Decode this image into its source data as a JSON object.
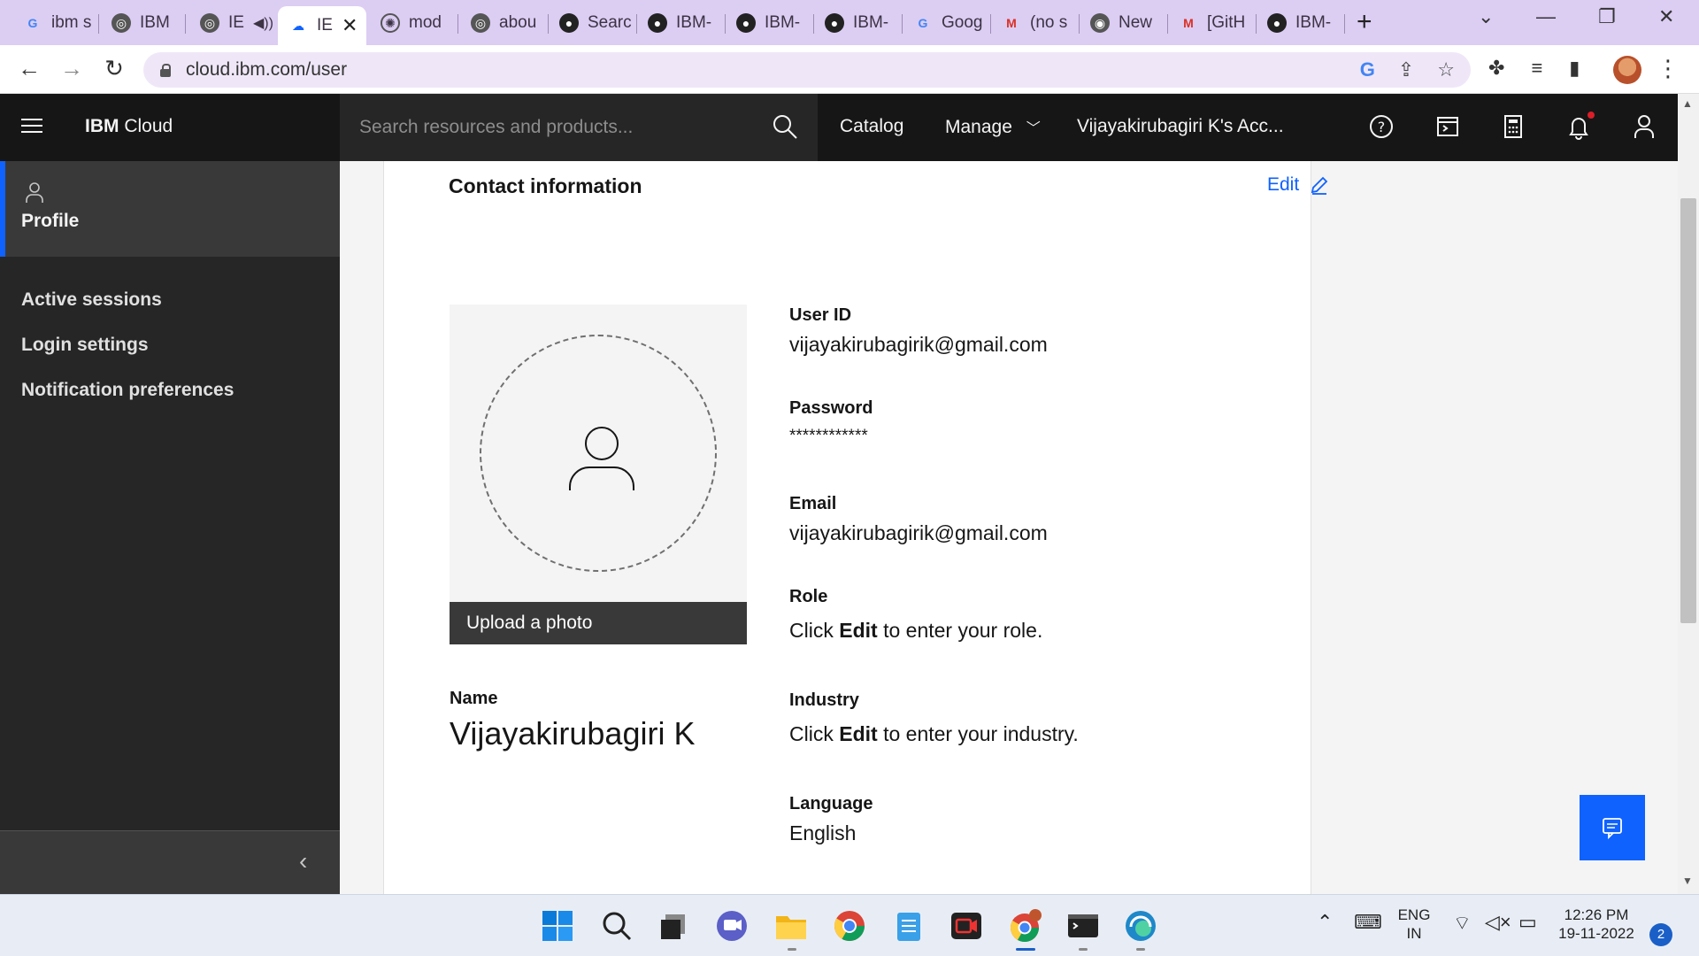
{
  "browser": {
    "tabs": [
      {
        "label": "ibm s",
        "icon": "google-icon"
      },
      {
        "label": "IBM",
        "icon": "globe-icon"
      },
      {
        "label": "IE",
        "icon": "globe-icon",
        "audio": true
      },
      {
        "label": "IE",
        "icon": "ibm-cloud-icon",
        "active": true
      },
      {
        "label": "mod",
        "icon": "nodered-icon"
      },
      {
        "label": "abou",
        "icon": "globe-icon"
      },
      {
        "label": "Searc",
        "icon": "github-icon"
      },
      {
        "label": "IBM-",
        "icon": "github-icon"
      },
      {
        "label": "IBM-",
        "icon": "github-icon"
      },
      {
        "label": "IBM-",
        "icon": "github-icon"
      },
      {
        "label": "Goog",
        "icon": "google-icon"
      },
      {
        "label": "(no s",
        "icon": "gmail-icon"
      },
      {
        "label": "New",
        "icon": "chrome-icon"
      },
      {
        "label": "[GitH",
        "icon": "gmail-icon"
      },
      {
        "label": "IBM-",
        "icon": "github-icon"
      }
    ],
    "url": "cloud.ibm.com/user"
  },
  "header": {
    "brand_bold": "IBM",
    "brand_rest": " Cloud",
    "search_placeholder": "Search resources and products...",
    "catalog": "Catalog",
    "manage": "Manage",
    "account": "Vijayakirubagiri K's Acc..."
  },
  "sidebar": {
    "active_item": "Profile",
    "items": [
      "Active sessions",
      "Login settings",
      "Notification preferences"
    ]
  },
  "card": {
    "title": "Contact information",
    "edit": "Edit",
    "upload": "Upload a photo",
    "name_label": "Name",
    "name_value": "Vijayakirubagiri K",
    "fields": {
      "user_id": {
        "label": "User ID",
        "value": "vijayakirubagirik@gmail.com"
      },
      "password": {
        "label": "Password",
        "value": "************"
      },
      "email": {
        "label": "Email",
        "value": "vijayakirubagirik@gmail.com"
      },
      "role": {
        "label": "Role",
        "pre": "Click ",
        "strong": "Edit",
        "post": " to enter your role."
      },
      "industry": {
        "label": "Industry",
        "pre": "Click ",
        "strong": "Edit",
        "post": " to enter your industry."
      },
      "language": {
        "label": "Language",
        "value": "English"
      }
    }
  },
  "taskbar": {
    "lang_top": "ENG",
    "lang_bottom": "IN",
    "time": "12:26 PM",
    "date": "19-11-2022",
    "notifications": "2"
  },
  "colors": {
    "accent": "#0f62fe",
    "header_bg": "#161616",
    "sidebar_bg": "#262626",
    "tabbar_bg": "#dccdf3"
  }
}
